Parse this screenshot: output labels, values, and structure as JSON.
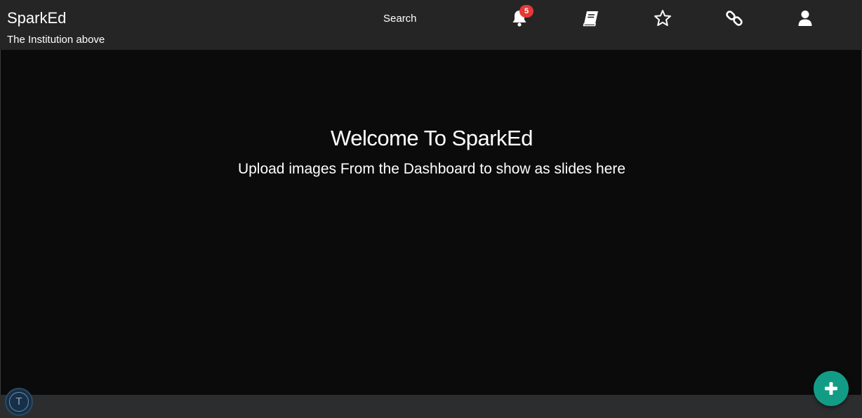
{
  "header": {
    "brand": "SparkEd",
    "subtitle": "The Institution above",
    "search_label": "Search",
    "notifications_count": "5",
    "icons": [
      "bell-icon",
      "book-icon",
      "star-icon",
      "link-icon",
      "user-icon"
    ]
  },
  "main": {
    "welcome_title": "Welcome To SparkEd",
    "welcome_subtitle": "Upload images From the Dashboard to show as slides here"
  },
  "footer": {
    "avatar_letter": "T"
  },
  "colors": {
    "navbar_bg": "#252526",
    "main_bg": "#0b0b0c",
    "badge": "#e53935",
    "fab": "#129c85"
  }
}
